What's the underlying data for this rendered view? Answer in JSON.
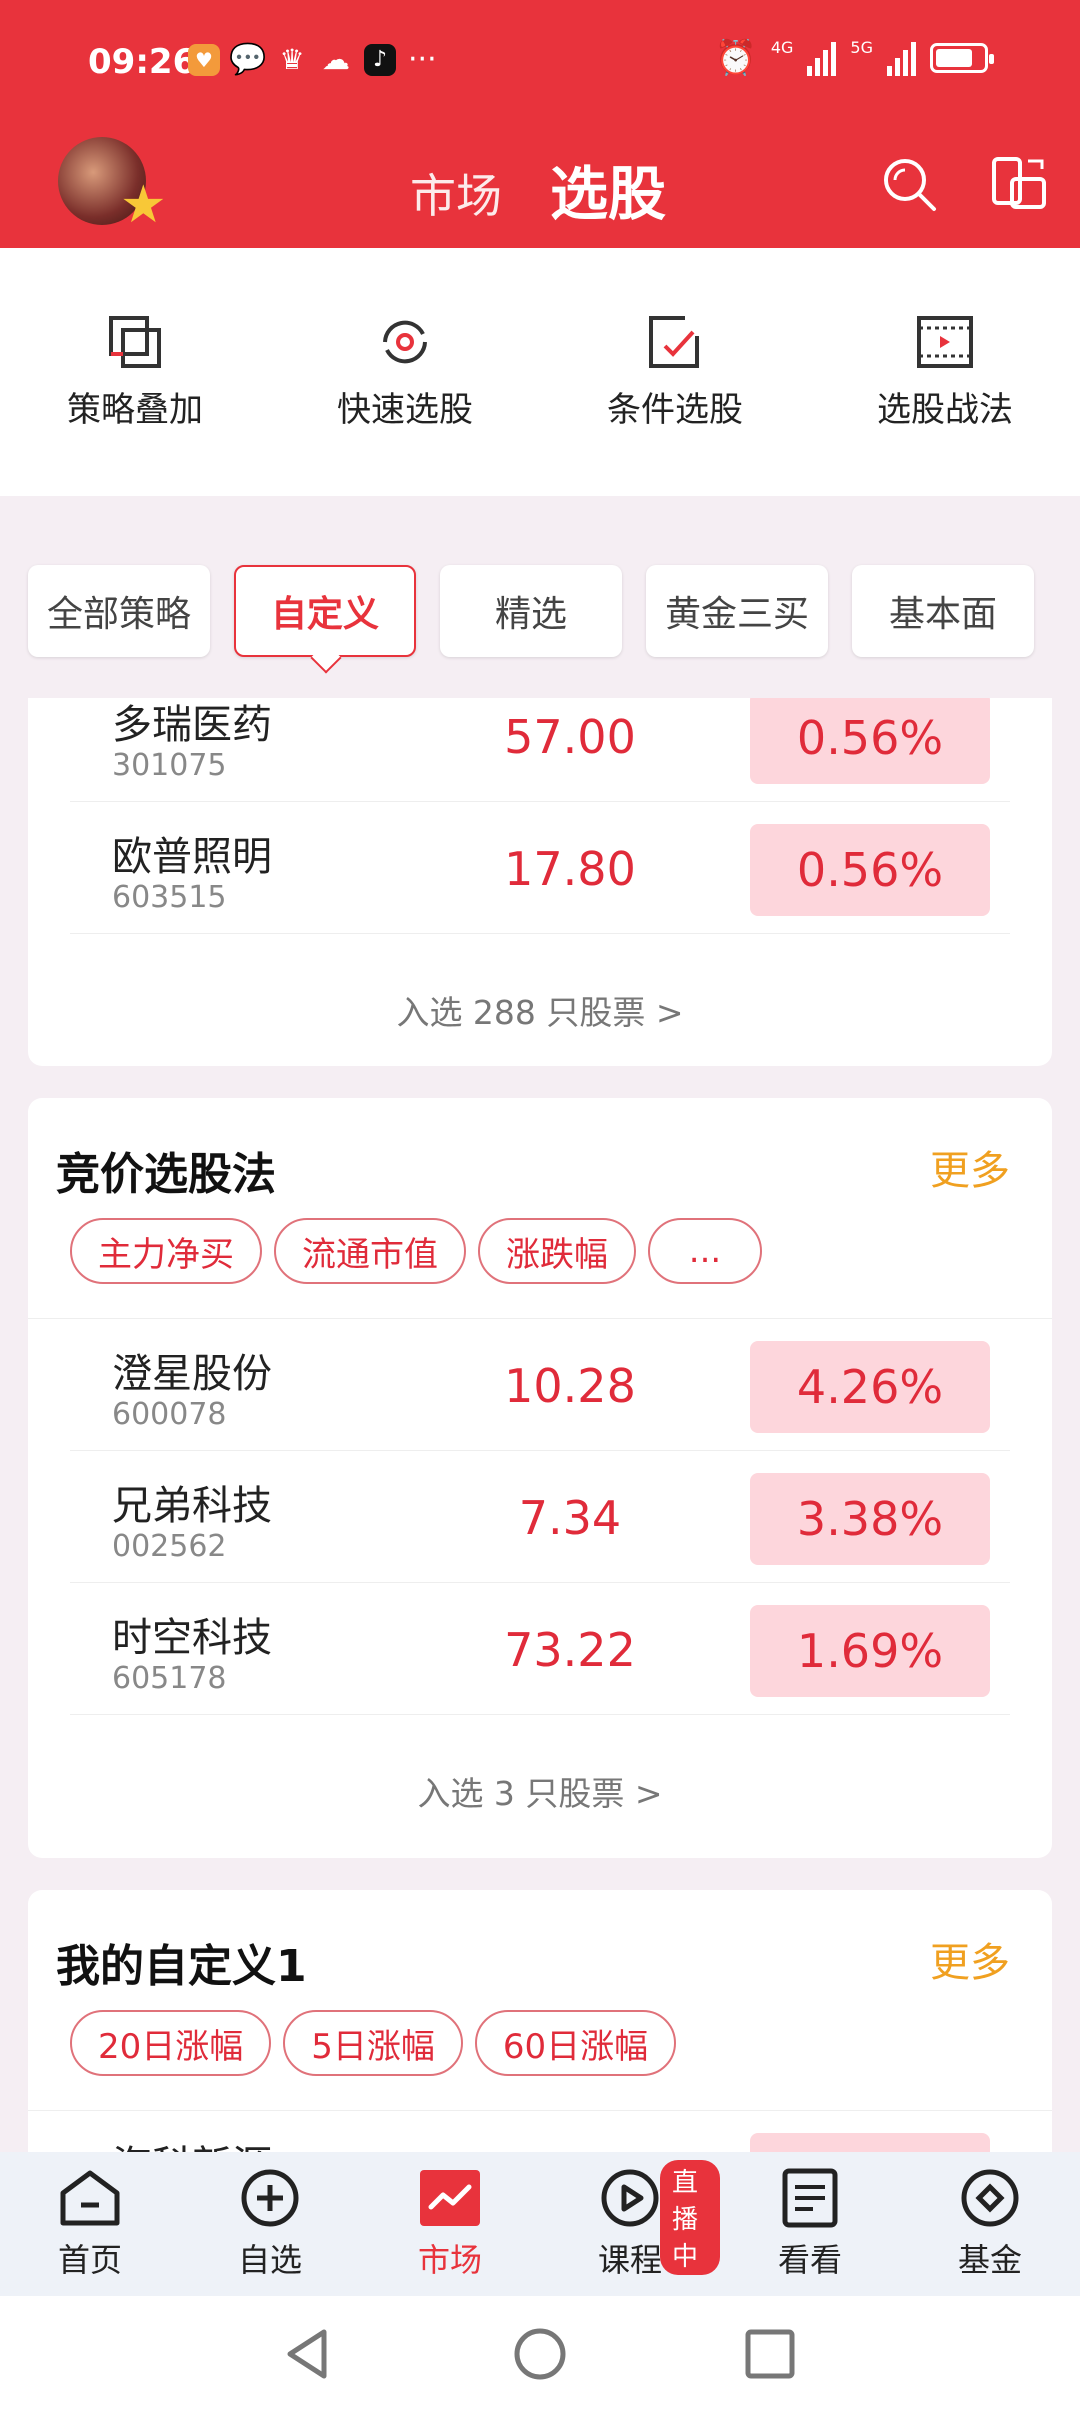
{
  "status_bar": {
    "time": "09:26",
    "more": "···",
    "signal1": "4G",
    "signal2": "5G"
  },
  "header": {
    "tab_market": "市场",
    "tab_pick": "选股"
  },
  "toolbar": {
    "items": [
      {
        "label": "策略叠加"
      },
      {
        "label": "快速选股"
      },
      {
        "label": "条件选股"
      },
      {
        "label": "选股战法"
      }
    ]
  },
  "strategy_tabs": {
    "items": [
      "全部策略",
      "自定义",
      "精选",
      "黄金三买",
      "基本面"
    ],
    "active": "自定义"
  },
  "card1": {
    "rows": [
      {
        "name": "多瑞医药",
        "code": "301075",
        "price": "57.00",
        "pct": "0.56%"
      },
      {
        "name": "欧普照明",
        "code": "603515",
        "price": "17.80",
        "pct": "0.56%"
      }
    ],
    "footer": "入选 288 只股票 >"
  },
  "card2": {
    "title": "竞价选股法",
    "more": "更多",
    "tags": [
      "主力净买",
      "流通市值",
      "涨跌幅",
      "..."
    ],
    "rows": [
      {
        "name": "澄星股份",
        "code": "600078",
        "price": "10.28",
        "pct": "4.26%"
      },
      {
        "name": "兄弟科技",
        "code": "002562",
        "price": "7.34",
        "pct": "3.38%"
      },
      {
        "name": "时空科技",
        "code": "605178",
        "price": "73.22",
        "pct": "1.69%"
      }
    ],
    "footer": "入选 3 只股票 >"
  },
  "card3": {
    "title": "我的自定义1",
    "more": "更多",
    "tags": [
      "20日涨幅",
      "5日涨幅",
      "60日涨幅"
    ],
    "rows": [
      {
        "name": "海科新源"
      }
    ]
  },
  "bottom_nav": {
    "items": [
      {
        "label": "首页"
      },
      {
        "label": "自选"
      },
      {
        "label": "市场"
      },
      {
        "label": "课程"
      },
      {
        "label": "看看"
      },
      {
        "label": "基金"
      }
    ],
    "live_badge": "直播中"
  },
  "colors": {
    "accent": "#e8333c",
    "up": "#e02b3a",
    "up_bg": "#fdd6dc",
    "more": "#f0a020"
  }
}
